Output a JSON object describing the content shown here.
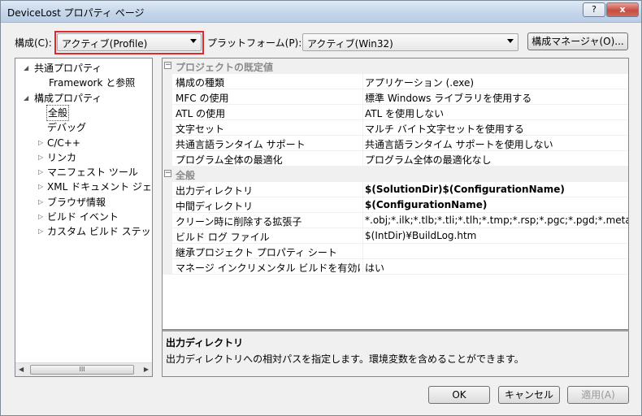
{
  "window": {
    "title": "DeviceLost プロパティ ページ",
    "help_label": "?",
    "close_label": "x"
  },
  "toolbar": {
    "config_label": "構成(C):",
    "config_value": "アクティブ(Profile)",
    "platform_label": "プラットフォーム(P):",
    "platform_value": "アクティブ(Win32)",
    "manager_label": "構成マネージャ(O)..."
  },
  "tree": {
    "items": [
      {
        "label": "共通プロパティ",
        "expander": "◢"
      },
      {
        "label": "Framework と参照",
        "expander": ""
      },
      {
        "label": "構成プロパティ",
        "expander": "◢"
      },
      {
        "label": "全般",
        "expander": ""
      },
      {
        "label": "デバッグ",
        "expander": ""
      },
      {
        "label": "C/C++",
        "expander": "▷"
      },
      {
        "label": "リンカ",
        "expander": "▷"
      },
      {
        "label": "マニフェスト ツール",
        "expander": "▷"
      },
      {
        "label": "XML ドキュメント ジェネ",
        "expander": "▷"
      },
      {
        "label": "ブラウザ情報",
        "expander": "▷"
      },
      {
        "label": "ビルド イベント",
        "expander": "▷"
      },
      {
        "label": "カスタム ビルド ステップ",
        "expander": "▷"
      }
    ],
    "scroll_thumb": "III"
  },
  "grid": {
    "categories": [
      {
        "name": "プロジェクトの既定値",
        "rows": [
          {
            "name": "構成の種類",
            "value": "アプリケーション (.exe)"
          },
          {
            "name": "MFC の使用",
            "value": "標準 Windows ライブラリを使用する"
          },
          {
            "name": "ATL の使用",
            "value": "ATL を使用しない"
          },
          {
            "name": "文字セット",
            "value": "マルチ バイト文字セットを使用する"
          },
          {
            "name": "共通言語ランタイム サポート",
            "value": "共通言語ランタイム サポートを使用しない"
          },
          {
            "name": "プログラム全体の最適化",
            "value": "プログラム全体の最適化なし"
          }
        ]
      },
      {
        "name": "全般",
        "rows": [
          {
            "name": "出力ディレクトリ",
            "value": "$(SolutionDir)$(ConfigurationName)"
          },
          {
            "name": "中間ディレクトリ",
            "value": "$(ConfigurationName)"
          },
          {
            "name": "クリーン時に削除する拡張子",
            "value": "*.obj;*.ilk;*.tlb;*.tli;*.tlh;*.tmp;*.rsp;*.pgc;*.pgd;*.meta;$("
          },
          {
            "name": "ビルド ログ ファイル",
            "value": "$(IntDir)¥BuildLog.htm"
          },
          {
            "name": "継承プロジェクト プロパティ シート",
            "value": ""
          },
          {
            "name": "マネージ インクリメンタル ビルドを有効にす",
            "value": "はい"
          }
        ]
      }
    ]
  },
  "description": {
    "title": "出力ディレクトリ",
    "text": "出力ディレクトリへの相対パスを指定します。環境変数を含めることができます。"
  },
  "buttons": {
    "ok": "OK",
    "cancel": "キャンセル",
    "apply": "適用(A)"
  }
}
